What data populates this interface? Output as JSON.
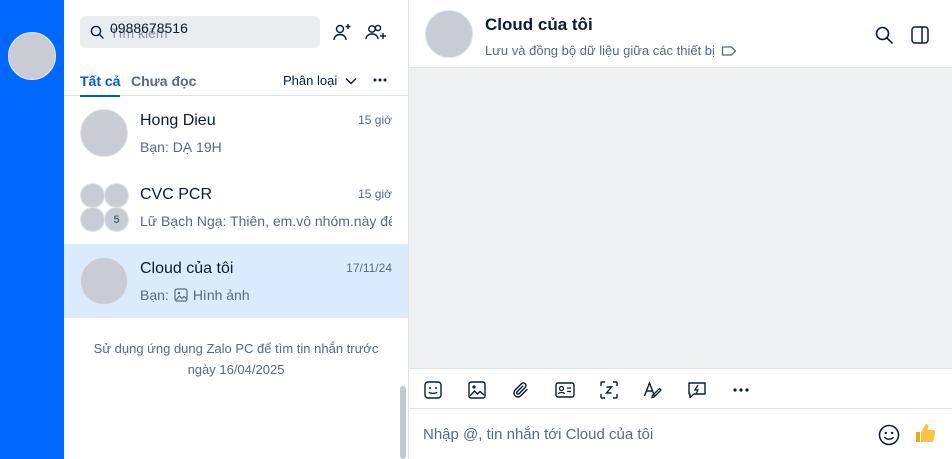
{
  "sidebar_rail": {
    "avatar_label": ""
  },
  "search": {
    "placeholder": "Tìm kiếm",
    "value": "0988678516"
  },
  "tabs": {
    "all": "Tất cả",
    "unread": "Chưa đọc",
    "filter": "Phân loại"
  },
  "conversations": [
    {
      "name": "Hong Dieu",
      "time": "15 giờ",
      "preview": "Bạn: DẠ 19H"
    },
    {
      "name": "CVC PCR",
      "time": "15 giờ",
      "preview": "Lữ Bạch Ngạ: Thiên, em.vô nhóm.này để",
      "member_count": "5"
    },
    {
      "name": "Cloud của tôi",
      "time": "17/11/24",
      "preview_prefix": "Bạn:",
      "preview": "Hình ảnh"
    }
  ],
  "hint": "Sử dụng ứng dụng Zalo PC để tìm tin nhắn trước ngày 16/04/2025",
  "chat": {
    "title": "Cloud của tôi",
    "subtitle": "Lưu và đồng bộ dữ liệu giữa các thiết bị",
    "composer_placeholder": "Nhập @, tin nhắn tới Cloud của tôi"
  },
  "colors": {
    "rail": "#0068ff",
    "accent": "#005ae0",
    "selected": "#dbebfe",
    "chat_bg": "#eef0f1"
  }
}
